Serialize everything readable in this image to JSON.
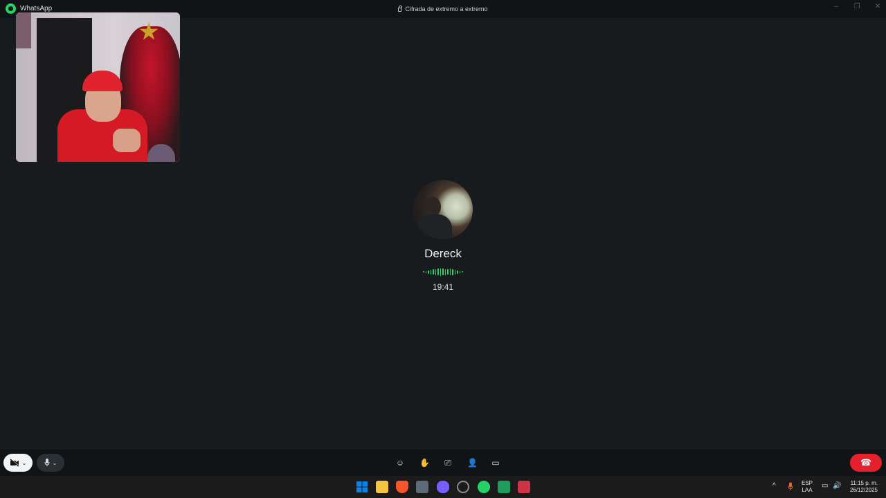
{
  "titlebar": {
    "app_name": "WhatsApp",
    "encryption_text": "Cifrada de extremo a extremo",
    "minimize": "–",
    "restore": "❐",
    "close": "✕"
  },
  "call": {
    "peer_name": "Dereck",
    "duration": "19:41"
  },
  "controls": {
    "camera_icon": "video-off",
    "mic_icon": "microphone",
    "chevron": "⌄",
    "tools": [
      {
        "name": "reactions-icon",
        "glyph": "☺"
      },
      {
        "name": "raise-hand-icon",
        "glyph": "✋"
      },
      {
        "name": "screen-share-icon",
        "glyph": "⎚"
      },
      {
        "name": "add-participant-icon",
        "glyph": "👤"
      },
      {
        "name": "captions-icon",
        "glyph": "▭"
      }
    ],
    "end_call_glyph": "☎"
  },
  "taskbar": {
    "language_top": "ESP",
    "language_bottom": "LAA",
    "time": "11:15 p. m.",
    "date": "26/12/2025",
    "tray_chevron": "^",
    "colors": {
      "start": "#0078d4",
      "explorer": "#f5c542",
      "brave": "#fb542b",
      "store": "#5d6a78",
      "game": "#7b5cff",
      "clock": "#8a8f94",
      "whatsapp": "#25d366",
      "sheets": "#1e9c5b",
      "other": "#cc3344"
    }
  },
  "accent": {
    "whatsapp_green": "#25d366",
    "end_call_red": "#e5212e"
  }
}
